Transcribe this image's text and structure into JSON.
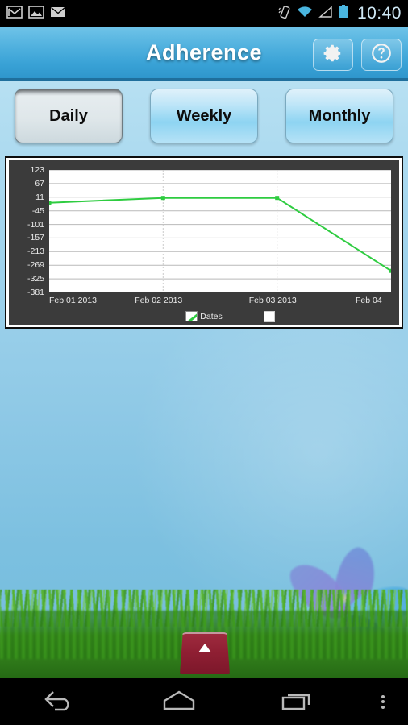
{
  "statusbar": {
    "time": "10:40",
    "icons": [
      {
        "name": "gmail-icon"
      },
      {
        "name": "photo-icon"
      },
      {
        "name": "email-icon"
      }
    ],
    "right_icons": [
      {
        "name": "vibrate-icon"
      },
      {
        "name": "wifi-icon"
      },
      {
        "name": "cell-signal-icon"
      },
      {
        "name": "battery-icon"
      }
    ]
  },
  "actionbar": {
    "title": "Adherence",
    "settings_label": "gear-icon",
    "help_label": "help-icon",
    "accent": "#39a2d6"
  },
  "tabs": [
    {
      "label": "Daily",
      "selected": true
    },
    {
      "label": "Weekly",
      "selected": false
    },
    {
      "label": "Monthly",
      "selected": false
    }
  ],
  "chart_data": {
    "type": "line",
    "title": "",
    "xlabel": "",
    "ylabel": "",
    "x": [
      "Feb 01 2013",
      "Feb 02 2013",
      "Feb 03 2013",
      "Feb 04"
    ],
    "series": [
      {
        "name": "Dates",
        "color": "#2ecc40",
        "values": [
          -12,
          8,
          8,
          -292
        ]
      }
    ],
    "ytick_labels": [
      "123",
      "67",
      "11",
      "-45",
      "-101",
      "-157",
      "-213",
      "-269",
      "-325",
      "-381"
    ],
    "ytick_values": [
      123,
      67,
      11,
      -45,
      -101,
      -157,
      -213,
      -269,
      -325,
      -381
    ],
    "ylim": [
      -381,
      123
    ],
    "xtick_labels": [
      "Feb 01 2013",
      "Feb 02 2013",
      "Feb 03 2013",
      "Feb 04"
    ],
    "grid": true,
    "legend_position": "bottom",
    "legend": [
      {
        "label": "Dates",
        "color": "#2ecc40"
      }
    ],
    "background": "#3b3b3b",
    "plot_background": "#ffffff"
  },
  "wallpaper": {
    "drawer_handle": "app-drawer-handle",
    "arrow": "up-arrow-icon"
  },
  "navbar": [
    {
      "name": "back-button",
      "label": "back-icon"
    },
    {
      "name": "home-button",
      "label": "home-icon"
    },
    {
      "name": "recents-button",
      "label": "recents-icon"
    },
    {
      "name": "overflow-button",
      "label": "overflow-menu-icon"
    }
  ]
}
